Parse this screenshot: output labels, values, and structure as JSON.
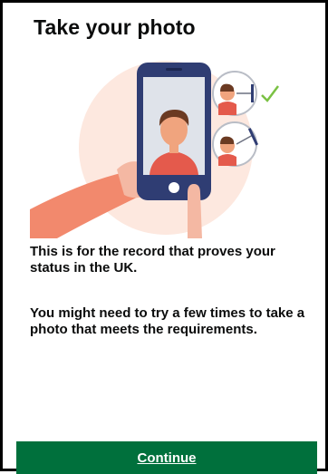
{
  "header": {
    "title": "Take your photo"
  },
  "illustration": {
    "icon_name": "selfie-phone-illustration",
    "accent_color": "#7ac143"
  },
  "main": {
    "paragraph_1": "This is for the record that proves your status in the UK.",
    "paragraph_2": "You might need to try a few times to take a photo that meets the requirements."
  },
  "footer": {
    "continue_label": "Continue",
    "button_color": "#00703c"
  }
}
